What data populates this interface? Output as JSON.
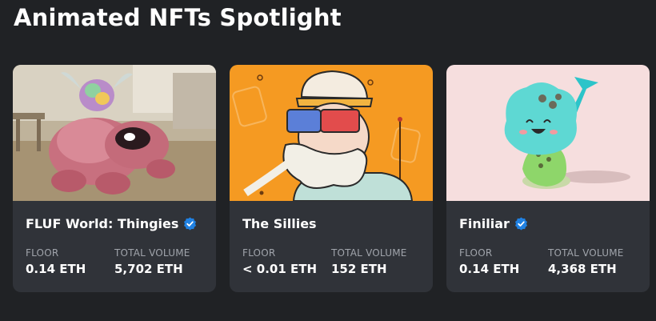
{
  "section": {
    "title": "Animated NFTs Spotlight"
  },
  "cards": [
    {
      "name": "FLUF World: Thingies",
      "verified": true,
      "floor_label": "FLOOR",
      "floor_value": "0.14 ETH",
      "volume_label": "TOTAL VOLUME",
      "volume_value": "5,702 ETH",
      "image": "pink-fluffy-creature-with-rainbow-hat"
    },
    {
      "name": "The Sillies",
      "verified": false,
      "floor_label": "FLOOR",
      "floor_value": "< 0.01 ETH",
      "volume_label": "TOTAL VOLUME",
      "volume_value": "152 ETH",
      "image": "old-man-with-3d-glasses-on-orange"
    },
    {
      "name": "Finiliar",
      "verified": true,
      "floor_label": "FLOOR",
      "floor_value": "0.14 ETH",
      "volume_label": "TOTAL VOLUME",
      "volume_value": "4,368 ETH",
      "image": "teal-green-blob-character-on-pink"
    }
  ],
  "colors": {
    "background": "#202225",
    "card": "#303339",
    "verified": "#2081e2",
    "label": "#a0a4ab"
  }
}
